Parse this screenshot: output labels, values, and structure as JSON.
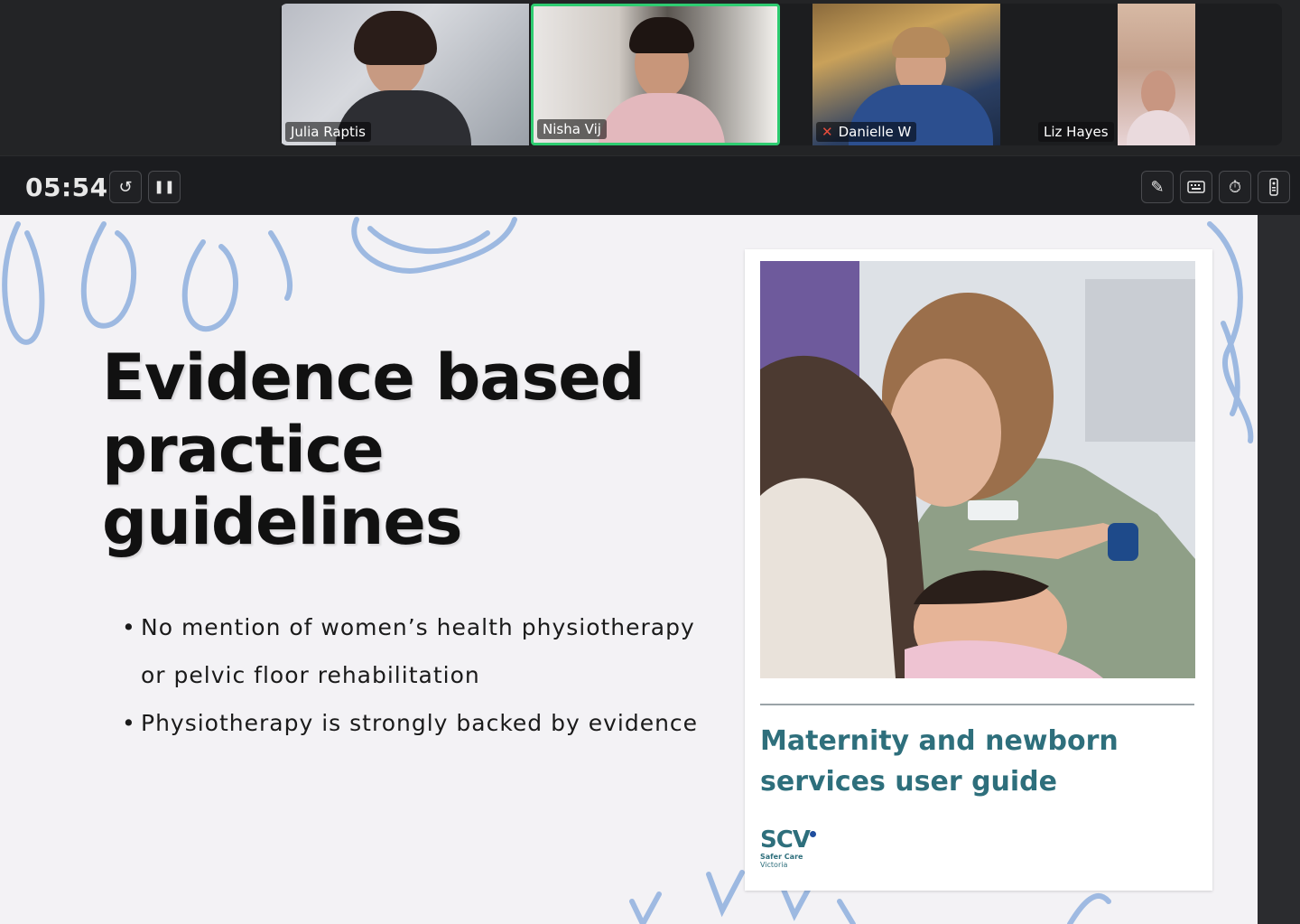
{
  "participants": [
    {
      "name": "Julia Raptis",
      "muted": false,
      "active": false
    },
    {
      "name": "Nisha Vij",
      "muted": false,
      "active": true
    },
    {
      "name": "Danielle W",
      "muted": true,
      "active": false
    },
    {
      "name": "Liz Hayes",
      "muted": false,
      "active": false
    }
  ],
  "controls": {
    "timer": "05:54",
    "icons": [
      "reset-timer-icon",
      "pause-icon",
      "pen-icon",
      "keyboard-icon",
      "stopwatch-icon",
      "remote-icon"
    ]
  },
  "slide": {
    "title_lines": [
      "Evidence based",
      "practice",
      "guidelines"
    ],
    "bullets": [
      "No mention of women’s health physiotherapy or pelvic floor rehabilitation",
      "Physiotherapy is strongly backed by evidence"
    ],
    "card": {
      "title_lines": [
        "Maternity and newborn",
        "services user guide"
      ],
      "logo_mark": "SCV",
      "logo_line1": "Safer Care",
      "logo_line2": "Victoria"
    }
  },
  "colors": {
    "active_border": "#2ecc71",
    "accent_teal": "#2e6f7c",
    "scribble_blue": "#8fb0de"
  }
}
